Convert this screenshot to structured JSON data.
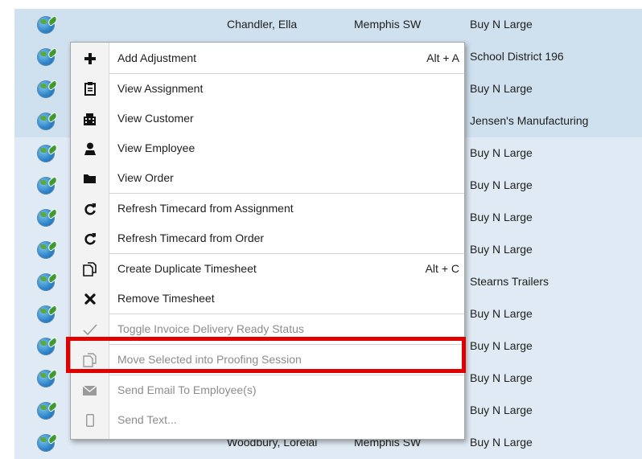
{
  "rows": [
    {
      "name": "Chandler, Ella",
      "branch": "Memphis SW",
      "customer": "Buy N Large"
    },
    {
      "name": "",
      "branch": "",
      "customer": "School District 196"
    },
    {
      "name": "",
      "branch": "",
      "customer": "Buy N Large"
    },
    {
      "name": "",
      "branch": "",
      "customer": "Jensen's Manufacturing"
    },
    {
      "name": "",
      "branch": "",
      "customer": "Buy N Large"
    },
    {
      "name": "",
      "branch": "",
      "customer": "Buy N Large"
    },
    {
      "name": "",
      "branch": "",
      "customer": "Buy N Large"
    },
    {
      "name": "",
      "branch": "",
      "customer": "Buy N Large"
    },
    {
      "name": "",
      "branch": "",
      "customer": "Stearns Trailers"
    },
    {
      "name": "",
      "branch": "",
      "customer": "Buy N Large"
    },
    {
      "name": "",
      "branch": "",
      "customer": "Buy N Large"
    },
    {
      "name": "",
      "branch": "",
      "customer": "Buy N Large"
    },
    {
      "name": "",
      "branch": "",
      "customer": "Buy N Large"
    },
    {
      "name": "Woodbury, Lorelai",
      "branch": "Memphis SW",
      "customer": "Buy N Large"
    }
  ],
  "menu": {
    "items": [
      {
        "label": "Add Adjustment",
        "shortcut": "Alt + A",
        "icon": "plus-icon"
      },
      {
        "label": "View Assignment",
        "shortcut": "",
        "icon": "clipboard-icon"
      },
      {
        "label": "View Customer",
        "shortcut": "",
        "icon": "building-icon"
      },
      {
        "label": "View Employee",
        "shortcut": "",
        "icon": "person-icon"
      },
      {
        "label": "View Order",
        "shortcut": "",
        "icon": "folder-icon"
      },
      {
        "label": "Refresh Timecard from Assignment",
        "shortcut": "",
        "icon": "refresh-icon"
      },
      {
        "label": "Refresh Timecard from Order",
        "shortcut": "",
        "icon": "refresh-icon"
      },
      {
        "label": "Create Duplicate Timesheet",
        "shortcut": "Alt + C",
        "icon": "duplicate-icon"
      },
      {
        "label": "Remove Timesheet",
        "shortcut": "",
        "icon": "x-icon"
      },
      {
        "label": "Toggle Invoice Delivery Ready Status",
        "shortcut": "",
        "icon": "checkmark-icon"
      },
      {
        "label": "Move Selected into Proofing Session",
        "shortcut": "",
        "icon": "duplicate-icon"
      },
      {
        "label": "Send Email To Employee(s)",
        "shortcut": "",
        "icon": "envelope-icon"
      },
      {
        "label": "Send Text...",
        "shortcut": "",
        "icon": "phone-icon"
      }
    ]
  },
  "colors": {
    "highlight_box": "#e00000",
    "row_selected": "#cfe0ee"
  }
}
